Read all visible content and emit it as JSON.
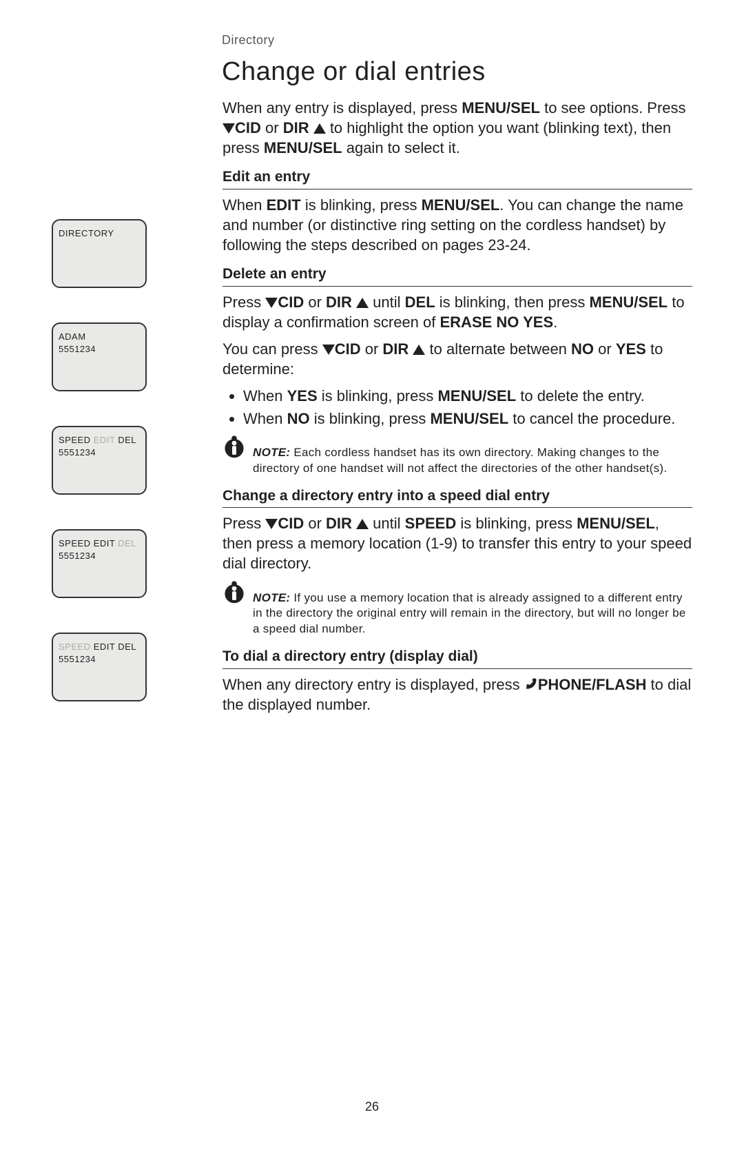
{
  "breadcrumb": "Directory",
  "title": "Change or dial entries",
  "intro": {
    "p1a": "When any entry is displayed, press ",
    "menusel": "MENU/",
    "sel": "SEL",
    "p1b": " to see options. Press ",
    "cid": "CID",
    "or": " or ",
    "dir": "DIR",
    "p1c": " to highlight the option you want (blinking text), then press ",
    "menu2": "MENU",
    "sel2": "/SEL",
    "p1d": " again to select it."
  },
  "sections": {
    "edit": {
      "h": "Edit an entry",
      "t1": "When ",
      "edit": "EDIT",
      "t2": " is blinking, press ",
      "menu": "MENU",
      "sel": "/SEL",
      "t3": ". You can change the name and number (or distinctive ring setting on the cordless handset) by following the steps described on pages 23-24."
    },
    "delete": {
      "h": "Delete an entry",
      "p1a": "Press ",
      "cid": "CID",
      "or": " or ",
      "dir": "DIR",
      "p1b": " until ",
      "del": "DEL",
      "p1c": " is blinking, then press ",
      "menu": "MENU",
      "sel": "/SEL",
      "p1d": " to display a confirmation screen of ",
      "erase": "ERASE NO YES",
      "dot": ".",
      "p2a": "You can press ",
      "p2b": " to alternate between ",
      "no": "NO",
      "or2": " or ",
      "yes": "YES",
      "p2c": " to determine:",
      "li1a": "When ",
      "li1b": " is blinking, press ",
      "li1c": " to delete the entry.",
      "li2a": "When ",
      "li2b": " is blinking, press ",
      "li2c": " to cancel the procedure."
    },
    "note1": {
      "label": "NOTE:",
      "text": " Each cordless handset has its own directory. Making changes to the directory of one handset will not affect the directories of the other handset(s)."
    },
    "speed": {
      "h": "Change a directory entry into a speed dial entry",
      "p1a": "Press ",
      "cid": "CID",
      "or": " or ",
      "dir": "DIR",
      "p1b": " until ",
      "speed": "SPEED",
      "p1c": " is blinking, press ",
      "menu": "MENU",
      "sel": "/SEL",
      "p1d": ", then press a memory location (1-9) to transfer this entry to your speed dial directory."
    },
    "note2": {
      "label": "NOTE:",
      "text": " If you use a memory location that is already assigned to a different entry in the directory the original entry will remain in the directory, but will no longer be a speed dial number."
    },
    "dial": {
      "h": "To dial a directory entry (display dial)",
      "p1a": "When any directory entry is displayed, press ",
      "phone": "PHONE/",
      "flash": "FLASH",
      "p1b": " to dial the displayed number."
    }
  },
  "lcds": {
    "l1": {
      "line1": "DIRECTORY"
    },
    "l2": {
      "line1": "ADAM",
      "line2": "5551234"
    },
    "l3": {
      "w1": "SPEED",
      "w2": "EDIT",
      "w3": "DEL",
      "line2": "5551234"
    },
    "l4": {
      "w1": "SPEED",
      "w2": "EDIT",
      "w3": "DEL",
      "line2": "5551234"
    },
    "l5": {
      "w1": "SPEED",
      "w2": "EDIT",
      "w3": "DEL",
      "line2": "5551234"
    }
  },
  "pagenum": "26"
}
